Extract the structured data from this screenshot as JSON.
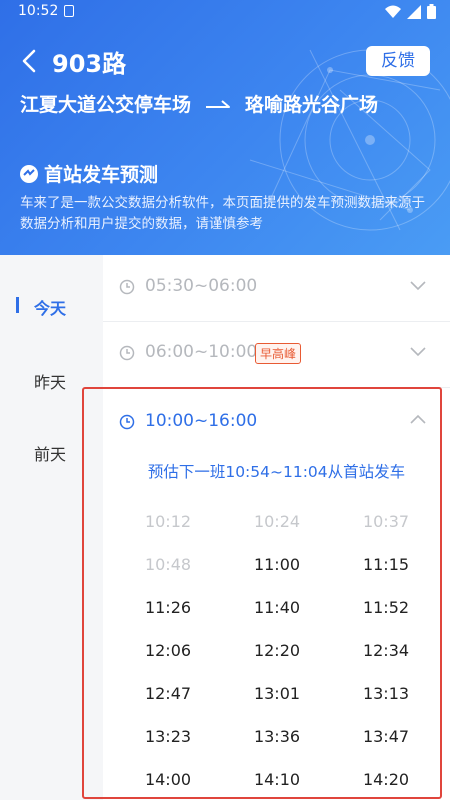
{
  "status_bar": {
    "time": "10:52"
  },
  "header": {
    "route_name": "903路",
    "feedback_label": "反馈",
    "origin": "江夏大道公交停车场",
    "destination": "珞喻路光谷广场",
    "predict_title": "首站发车预测",
    "disclaimer": "车来了是一款公交数据分析软件，本页面提供的发车预测数据来源于数据分析和用户提交的数据，请谨慎参考"
  },
  "sidebar": {
    "items": [
      {
        "label": "今天",
        "active": true
      },
      {
        "label": "昨天",
        "active": false
      },
      {
        "label": "前天",
        "active": false
      }
    ]
  },
  "slots": [
    {
      "label": "05:30~06:00",
      "badge": ""
    },
    {
      "label": "06:00~10:00",
      "badge": "早高峰"
    }
  ],
  "expanded_slot": {
    "label": "10:00~16:00",
    "next_estimate": "预估下一班10:54~11:04从首站发车",
    "times": [
      {
        "t": "10:12",
        "past": true
      },
      {
        "t": "10:24",
        "past": true
      },
      {
        "t": "10:37",
        "past": true
      },
      {
        "t": "10:48",
        "past": true
      },
      {
        "t": "11:00",
        "past": false
      },
      {
        "t": "11:15",
        "past": false
      },
      {
        "t": "11:26",
        "past": false
      },
      {
        "t": "11:40",
        "past": false
      },
      {
        "t": "11:52",
        "past": false
      },
      {
        "t": "12:06",
        "past": false
      },
      {
        "t": "12:20",
        "past": false
      },
      {
        "t": "12:34",
        "past": false
      },
      {
        "t": "12:47",
        "past": false
      },
      {
        "t": "13:01",
        "past": false
      },
      {
        "t": "13:13",
        "past": false
      },
      {
        "t": "13:23",
        "past": false
      },
      {
        "t": "13:36",
        "past": false
      },
      {
        "t": "13:47",
        "past": false
      },
      {
        "t": "14:00",
        "past": false
      },
      {
        "t": "14:10",
        "past": false
      },
      {
        "t": "14:20",
        "past": false
      }
    ]
  },
  "colors": {
    "accent": "#2f6fe7",
    "peak_badge": "#e85a33",
    "past_time": "#c6c8cc",
    "highlight_box": "#e0453c"
  }
}
